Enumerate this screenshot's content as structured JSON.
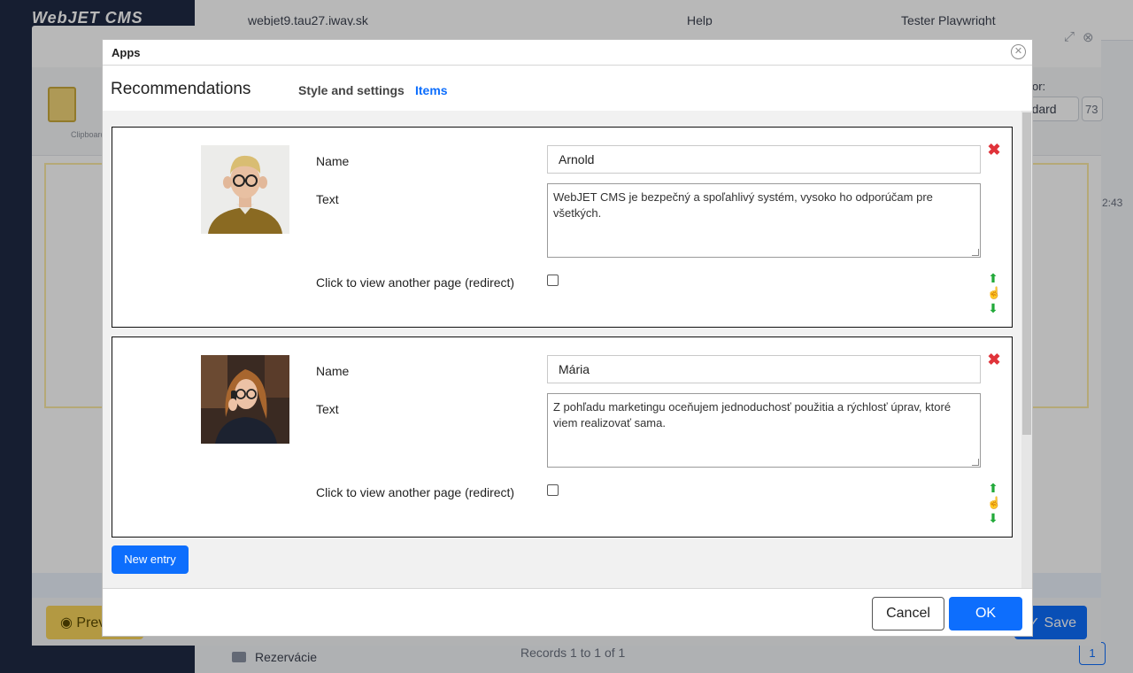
{
  "background": {
    "logo": "WebJET CMS",
    "domain": "webjet9.tau27.iway.sk",
    "help": "Help",
    "user": "Tester Playwright",
    "folder": "Rezervácie",
    "records": "Records 1 to 1 of 1",
    "page": "1",
    "editor": {
      "clipboard_label": "Clipboard",
      "right_label": "or:",
      "select_value": "andard",
      "count": "73",
      "time": "2:43",
      "preview_label": "Prev",
      "save_label": "Save"
    }
  },
  "modal": {
    "title": "Apps",
    "close_icon": "close-circle-icon",
    "app_name": "Recommendations",
    "tabs": [
      {
        "label": "Style and settings",
        "active": false
      },
      {
        "label": "Items",
        "active": true
      }
    ],
    "labels": {
      "name": "Name",
      "text": "Text",
      "redirect": "Click to view another page (redirect)"
    },
    "entries": [
      {
        "name": "Arnold",
        "text": "WebJET CMS je bezpečný a spoľahlivý systém, vysoko ho odporúčam pre všetkých.",
        "redirect_checked": false,
        "photo": "man-with-glasses-photo"
      },
      {
        "name": "Mária",
        "text": "Z pohľadu marketingu oceňujem jednoduchosť použitia a rýchlosť úprav, ktoré viem realizovať sama.",
        "redirect_checked": false,
        "photo": "woman-with-phone-photo"
      }
    ],
    "new_entry_label": "New entry",
    "cancel_label": "Cancel",
    "ok_label": "OK"
  },
  "colors": {
    "accent": "#0d6efd",
    "delete": "#e0333a",
    "move": "#22a93a"
  }
}
